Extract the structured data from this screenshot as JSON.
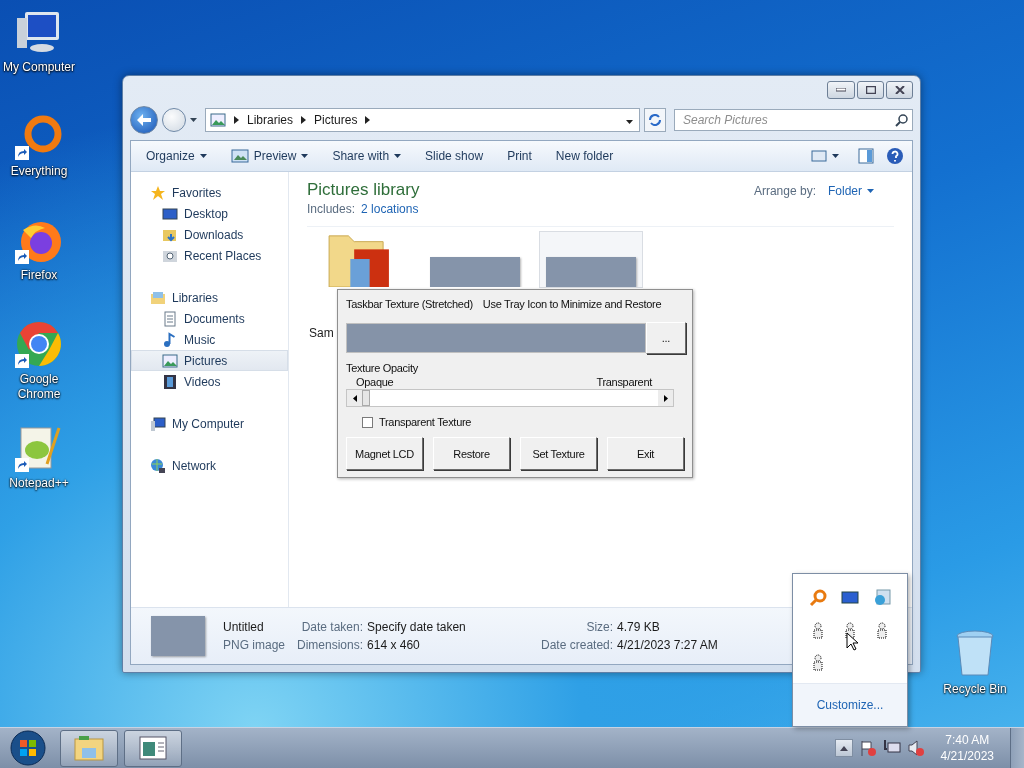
{
  "desktop_icons": [
    {
      "kind": "computer",
      "label": "My Computer",
      "shortcut": false
    },
    {
      "kind": "ring",
      "label": "Everything",
      "shortcut": true
    },
    {
      "kind": "fox",
      "label": "Firefox",
      "shortcut": true
    },
    {
      "kind": "chrome",
      "label": "Google Chrome",
      "shortcut": true
    },
    {
      "kind": "notepad",
      "label": "Notepad++",
      "shortcut": true
    }
  ],
  "recycle_bin": {
    "label": "Recycle Bin"
  },
  "explorer": {
    "breadcrumb": [
      "Libraries",
      "Pictures"
    ],
    "search": {
      "placeholder": "Search Pictures"
    },
    "toolbar": [
      {
        "label": "Organize",
        "dropdown": true,
        "icon": false
      },
      {
        "label": "Preview",
        "dropdown": true,
        "icon": true
      },
      {
        "label": "Share with",
        "dropdown": true,
        "icon": false
      },
      {
        "label": "Slide show",
        "dropdown": false,
        "icon": false
      },
      {
        "label": "Print",
        "dropdown": false,
        "icon": false
      },
      {
        "label": "New folder",
        "dropdown": false,
        "icon": false
      }
    ],
    "nav": [
      {
        "kind": "star",
        "label": "Favorites",
        "selected": false,
        "children": [
          {
            "kind": "desktop",
            "label": "Desktop",
            "selected": false
          },
          {
            "kind": "folder",
            "label": "Downloads",
            "selected": false
          },
          {
            "kind": "places",
            "label": "Recent Places",
            "selected": false
          }
        ]
      },
      {
        "kind": "library",
        "label": "Libraries",
        "selected": false,
        "children": [
          {
            "kind": "document",
            "label": "Documents",
            "selected": false
          },
          {
            "kind": "music",
            "label": "Music",
            "selected": false
          },
          {
            "kind": "picture",
            "label": "Pictures",
            "selected": true
          },
          {
            "kind": "video",
            "label": "Videos",
            "selected": false
          }
        ]
      },
      {
        "kind": "computer",
        "label": "My Computer",
        "selected": false
      },
      {
        "kind": "network",
        "label": "Network",
        "selected": false
      }
    ],
    "library": {
      "title": "Pictures library",
      "includes_label": "Includes:",
      "includes_link": "2 locations",
      "arrange_label": "Arrange by:",
      "arrange_value": "Folder"
    },
    "items": [
      {
        "kind": "folder",
        "label": "Sam",
        "selected": false
      },
      {
        "kind": "image",
        "selected": false
      },
      {
        "kind": "image",
        "selected": true
      }
    ],
    "details": {
      "name": "Untitled",
      "type": "PNG image",
      "fields": [
        {
          "label": "Date taken:",
          "value": "Specify date taken"
        },
        {
          "label": "Size:",
          "value": "4.79 KB"
        },
        {
          "label": "Dimensions:",
          "value": "614 x 460"
        },
        {
          "label": "Date created:",
          "value": "4/21/2023 7:27 AM"
        }
      ]
    }
  },
  "dialog": {
    "texture_label": "Taskbar Texture (Stretched)",
    "tray_hint": "Use Tray Icon to Minimize and Restore",
    "browse_button": "...",
    "opacity_label": "Texture Opacity",
    "min_label": "Opaque",
    "max_label": "Transparent",
    "opacity": {
      "level": 0
    },
    "transparent_texture": {
      "label": "Transparent Texture",
      "checked": false
    },
    "buttons": [
      "Magnet LCD",
      "Restore",
      "Set Texture",
      "Exit"
    ]
  },
  "tray_popup": {
    "icons": [
      {
        "kind": "search"
      },
      {
        "kind": "monitor"
      },
      {
        "kind": "globe"
      },
      {
        "kind": "blank"
      },
      {
        "kind": "blank"
      },
      {
        "kind": "blank"
      },
      {
        "kind": "blank"
      }
    ],
    "customize_link": "Customize..."
  },
  "taskbar": {
    "buttons": [
      {
        "kind": "explorer"
      },
      {
        "kind": "app"
      }
    ],
    "tray": [
      {
        "kind": "flag"
      },
      {
        "kind": "network"
      },
      {
        "kind": "volume"
      }
    ],
    "time": "7:40 AM",
    "date": "4/21/2023"
  }
}
